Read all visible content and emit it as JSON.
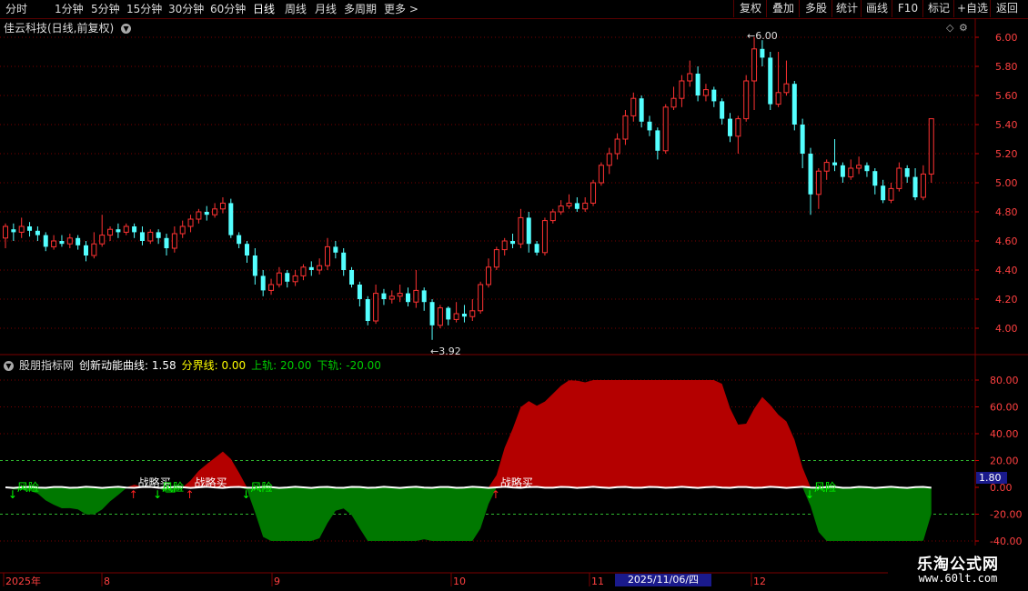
{
  "toolbar": {
    "tabs": [
      "分时",
      "1分钟",
      "5分钟",
      "15分钟",
      "30分钟",
      "60分钟",
      "日线",
      "周线",
      "月线",
      "多周期",
      "更多 >"
    ],
    "active_tab": "日线",
    "right_buttons": [
      "复权",
      "叠加",
      "多股",
      "统计",
      "画线",
      "F10",
      "标记",
      "+自选",
      "返回"
    ]
  },
  "chart_title": "佳云科技(日线,前复权)",
  "price_axis": [
    "6.00",
    "5.80",
    "5.60",
    "5.40",
    "5.20",
    "5.00",
    "4.80",
    "4.60",
    "4.40",
    "4.20",
    "4.00"
  ],
  "price_annotations": {
    "high": "6.00",
    "low": "3.92"
  },
  "indicator": {
    "name": "股朋指标网",
    "curve_label": "创新动能曲线: 1.58",
    "boundary_label": "分界线: 0.00",
    "upper_label": "上轨: 20.00",
    "lower_label": "下轨: -20.00",
    "axis": [
      "80.00",
      "60.00",
      "40.00",
      "20.00",
      "0.00",
      "-20.00",
      "-40.00"
    ],
    "current_value": "1.80",
    "signal_labels": {
      "risk": "风险",
      "buy": "战略买"
    }
  },
  "date_axis": [
    "2025年",
    "8",
    "9",
    "10",
    "11",
    "12"
  ],
  "date_highlight": "2025/11/06/四",
  "watermark": {
    "title": "乐淘公式网",
    "url": "www.60lt.com"
  },
  "colors": {
    "up": "#ff3232",
    "down": "#54ffff",
    "red_fill": "#b40000",
    "green_fill": "#007800",
    "grid": "#7a0000",
    "white_curve": "#ffffff"
  },
  "chart_data": {
    "type": "candlestick",
    "ylim": [
      3.92,
      6.0
    ],
    "candles": [
      [
        4.62,
        4.7,
        4.55,
        4.72
      ],
      [
        4.68,
        4.66,
        4.6,
        4.72
      ],
      [
        4.66,
        4.7,
        4.62,
        4.76
      ],
      [
        4.7,
        4.67,
        4.63,
        4.73
      ],
      [
        4.67,
        4.64,
        4.6,
        4.7
      ],
      [
        4.64,
        4.56,
        4.53,
        4.66
      ],
      [
        4.56,
        4.6,
        4.54,
        4.64
      ],
      [
        4.6,
        4.58,
        4.56,
        4.64
      ],
      [
        4.58,
        4.62,
        4.55,
        4.65
      ],
      [
        4.62,
        4.57,
        4.54,
        4.64
      ],
      [
        4.57,
        4.5,
        4.46,
        4.6
      ],
      [
        4.5,
        4.58,
        4.48,
        4.66
      ],
      [
        4.58,
        4.64,
        4.56,
        4.78
      ],
      [
        4.64,
        4.68,
        4.6,
        4.7
      ],
      [
        4.68,
        4.66,
        4.62,
        4.72
      ],
      [
        4.66,
        4.7,
        4.64,
        4.72
      ],
      [
        4.7,
        4.66,
        4.62,
        4.72
      ],
      [
        4.66,
        4.6,
        4.57,
        4.7
      ],
      [
        4.6,
        4.66,
        4.58,
        4.68
      ],
      [
        4.66,
        4.62,
        4.58,
        4.68
      ],
      [
        4.62,
        4.55,
        4.5,
        4.65
      ],
      [
        4.55,
        4.65,
        4.52,
        4.7
      ],
      [
        4.65,
        4.7,
        4.62,
        4.74
      ],
      [
        4.7,
        4.75,
        4.66,
        4.78
      ],
      [
        4.75,
        4.8,
        4.72,
        4.82
      ],
      [
        4.8,
        4.78,
        4.74,
        4.84
      ],
      [
        4.78,
        4.82,
        4.76,
        4.86
      ],
      [
        4.82,
        4.86,
        4.79,
        4.9
      ],
      [
        4.86,
        4.64,
        4.62,
        4.89
      ],
      [
        4.64,
        4.58,
        4.55,
        4.66
      ],
      [
        4.58,
        4.5,
        4.45,
        4.6
      ],
      [
        4.5,
        4.36,
        4.3,
        4.55
      ],
      [
        4.36,
        4.26,
        4.22,
        4.4
      ],
      [
        4.26,
        4.3,
        4.23,
        4.34
      ],
      [
        4.3,
        4.38,
        4.28,
        4.42
      ],
      [
        4.38,
        4.32,
        4.28,
        4.4
      ],
      [
        4.32,
        4.36,
        4.29,
        4.4
      ],
      [
        4.36,
        4.42,
        4.33,
        4.44
      ],
      [
        4.42,
        4.4,
        4.36,
        4.46
      ],
      [
        4.4,
        4.43,
        4.37,
        4.48
      ],
      [
        4.43,
        4.56,
        4.4,
        4.62
      ],
      [
        4.56,
        4.52,
        4.48,
        4.6
      ],
      [
        4.52,
        4.4,
        4.36,
        4.55
      ],
      [
        4.4,
        4.3,
        4.28,
        4.42
      ],
      [
        4.3,
        4.2,
        4.15,
        4.32
      ],
      [
        4.2,
        4.05,
        4.02,
        4.22
      ],
      [
        4.05,
        4.24,
        4.03,
        4.3
      ],
      [
        4.24,
        4.2,
        4.16,
        4.27
      ],
      [
        4.2,
        4.22,
        4.17,
        4.26
      ],
      [
        4.22,
        4.24,
        4.18,
        4.3
      ],
      [
        4.24,
        4.18,
        4.15,
        4.28
      ],
      [
        4.18,
        4.26,
        4.14,
        4.4
      ],
      [
        4.26,
        4.18,
        4.12,
        4.28
      ],
      [
        4.18,
        4.02,
        3.92,
        4.2
      ],
      [
        4.02,
        4.14,
        4.0,
        4.16
      ],
      [
        4.14,
        4.06,
        4.02,
        4.15
      ],
      [
        4.06,
        4.1,
        4.04,
        4.18
      ],
      [
        4.1,
        4.08,
        4.04,
        4.16
      ],
      [
        4.08,
        4.12,
        4.05,
        4.2
      ],
      [
        4.12,
        4.3,
        4.1,
        4.32
      ],
      [
        4.3,
        4.42,
        4.28,
        4.48
      ],
      [
        4.42,
        4.54,
        4.4,
        4.56
      ],
      [
        4.54,
        4.6,
        4.5,
        4.62
      ],
      [
        4.6,
        4.58,
        4.55,
        4.65
      ],
      [
        4.58,
        4.76,
        4.55,
        4.82
      ],
      [
        4.76,
        4.58,
        4.52,
        4.8
      ],
      [
        4.58,
        4.52,
        4.5,
        4.6
      ],
      [
        4.52,
        4.74,
        4.5,
        4.76
      ],
      [
        4.74,
        4.8,
        4.72,
        4.82
      ],
      [
        4.8,
        4.84,
        4.78,
        4.88
      ],
      [
        4.84,
        4.86,
        4.82,
        4.92
      ],
      [
        4.86,
        4.82,
        4.8,
        4.9
      ],
      [
        4.82,
        4.86,
        4.8,
        4.9
      ],
      [
        4.86,
        5.0,
        4.84,
        5.02
      ],
      [
        5.0,
        5.12,
        4.98,
        5.14
      ],
      [
        5.12,
        5.2,
        5.06,
        5.24
      ],
      [
        5.2,
        5.3,
        5.16,
        5.34
      ],
      [
        5.3,
        5.46,
        5.26,
        5.5
      ],
      [
        5.46,
        5.58,
        5.42,
        5.62
      ],
      [
        5.58,
        5.42,
        5.38,
        5.6
      ],
      [
        5.42,
        5.36,
        5.32,
        5.46
      ],
      [
        5.36,
        5.22,
        5.16,
        5.38
      ],
      [
        5.22,
        5.52,
        5.2,
        5.54
      ],
      [
        5.52,
        5.58,
        5.5,
        5.66
      ],
      [
        5.58,
        5.7,
        5.52,
        5.74
      ],
      [
        5.7,
        5.75,
        5.66,
        5.84
      ],
      [
        5.75,
        5.6,
        5.56,
        5.8
      ],
      [
        5.6,
        5.64,
        5.56,
        5.68
      ],
      [
        5.64,
        5.56,
        5.52,
        5.66
      ],
      [
        5.56,
        5.44,
        5.4,
        5.58
      ],
      [
        5.44,
        5.32,
        5.28,
        5.48
      ],
      [
        5.32,
        5.44,
        5.2,
        5.46
      ],
      [
        5.44,
        5.7,
        5.42,
        5.74
      ],
      [
        5.7,
        5.92,
        5.5,
        6.0
      ],
      [
        5.92,
        5.86,
        5.8,
        5.98
      ],
      [
        5.86,
        5.54,
        5.5,
        5.9
      ],
      [
        5.54,
        5.62,
        5.52,
        5.9
      ],
      [
        5.62,
        5.68,
        5.6,
        5.84
      ],
      [
        5.68,
        5.4,
        5.36,
        5.7
      ],
      [
        5.4,
        5.2,
        5.1,
        5.44
      ],
      [
        5.2,
        4.92,
        4.78,
        5.24
      ],
      [
        4.92,
        5.08,
        4.82,
        5.1
      ],
      [
        5.08,
        5.14,
        5.02,
        5.16
      ],
      [
        5.14,
        5.12,
        5.08,
        5.3
      ],
      [
        5.12,
        5.04,
        5.0,
        5.14
      ],
      [
        5.04,
        5.1,
        5.02,
        5.16
      ],
      [
        5.1,
        5.12,
        5.06,
        5.18
      ],
      [
        5.12,
        5.08,
        5.04,
        5.14
      ],
      [
        5.08,
        4.98,
        4.92,
        5.1
      ],
      [
        4.98,
        4.88,
        4.86,
        5.02
      ],
      [
        4.88,
        4.96,
        4.86,
        5.0
      ],
      [
        4.96,
        5.1,
        4.94,
        5.14
      ],
      [
        5.1,
        5.04,
        5.0,
        5.12
      ],
      [
        5.04,
        4.9,
        4.88,
        5.1
      ],
      [
        4.9,
        5.06,
        4.88,
        5.12
      ],
      [
        5.06,
        5.44,
        5.0,
        5.44
      ]
    ]
  }
}
